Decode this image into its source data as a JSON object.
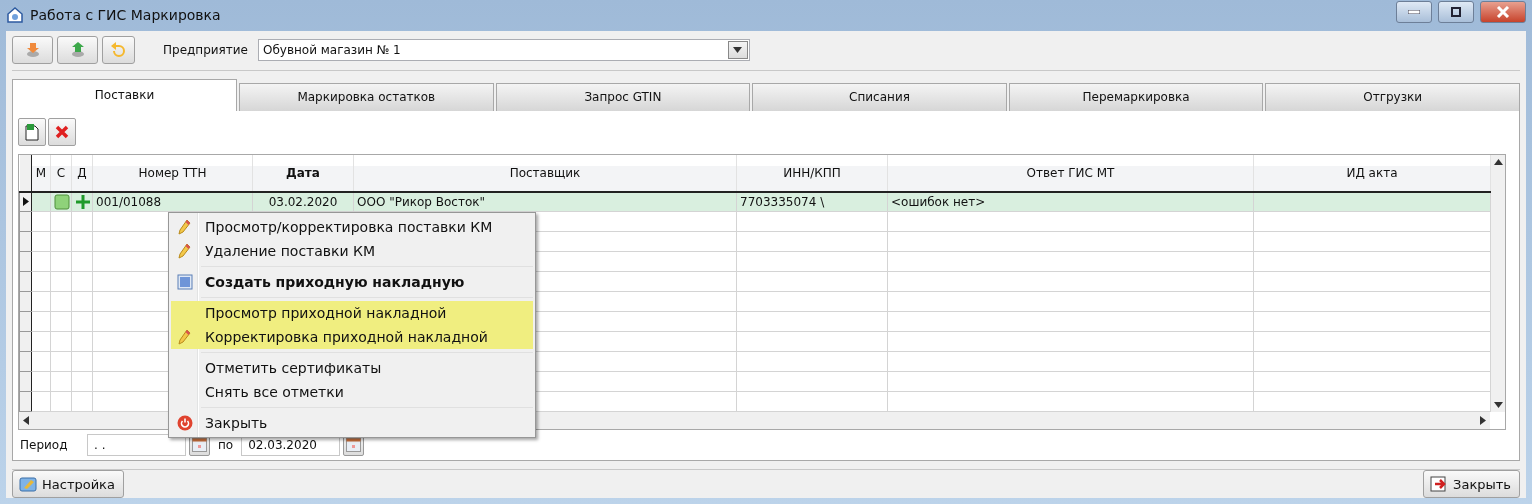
{
  "window": {
    "title": "Работа с ГИС Маркировка"
  },
  "enterprise": {
    "label": "Предприятие",
    "value": "Обувной магазин № 1"
  },
  "tabs": [
    {
      "label": "Поставки",
      "selected": true
    },
    {
      "label": "Маркировка остатков",
      "selected": false
    },
    {
      "label": "Запрос GTIN",
      "selected": false
    },
    {
      "label": "Списания",
      "selected": false
    },
    {
      "label": "Перемаркировка",
      "selected": false
    },
    {
      "label": "Отгрузки",
      "selected": false
    }
  ],
  "table": {
    "columns": [
      {
        "label": "М",
        "sorted": false
      },
      {
        "label": "С",
        "sorted": false
      },
      {
        "label": "Д",
        "sorted": false
      },
      {
        "label": "Номер ТТН",
        "sorted": false
      },
      {
        "label": "Дата",
        "sorted": true
      },
      {
        "label": "Поставщик",
        "sorted": false
      },
      {
        "label": "ИНН/КПП",
        "sorted": false
      },
      {
        "label": "Ответ ГИС МТ",
        "sorted": false
      },
      {
        "label": "ИД акта",
        "sorted": false
      }
    ],
    "rows": [
      {
        "current": true,
        "selected": true,
        "confirmed": true,
        "added": true,
        "number": "001/01088",
        "date": "03.02.2020",
        "supplier": "ООО \"Рикор Восток\"",
        "inn_kpp": "7703335074   \\",
        "response": "<ошибок нет>"
      }
    ]
  },
  "context_menu": [
    {
      "kind": "edit",
      "label": "Просмотр/корректировка поставки КМ",
      "bold": false,
      "highlighted": false
    },
    {
      "kind": "edit",
      "label": "Удаление поставки КМ",
      "bold": false,
      "highlighted": false
    },
    {
      "kind": "separator"
    },
    {
      "kind": "create",
      "label": "Создать приходную накладную",
      "bold": true,
      "highlighted": false
    },
    {
      "kind": "separator"
    },
    {
      "kind": "plain",
      "label": "Просмотр приходной накладной",
      "bold": false,
      "highlighted": true
    },
    {
      "kind": "edit",
      "label": "Корректировка приходной накладной",
      "bold": false,
      "highlighted": true
    },
    {
      "kind": "separator"
    },
    {
      "kind": "plain",
      "label": "Отметить сертификаты",
      "bold": false,
      "highlighted": false
    },
    {
      "kind": "plain",
      "label": "Снять все отметки",
      "bold": false,
      "highlighted": false
    },
    {
      "kind": "separator"
    },
    {
      "kind": "close",
      "label": "Закрыть",
      "bold": false,
      "highlighted": false
    }
  ],
  "period": {
    "label": "Период",
    "from": ". .",
    "to_label": "по",
    "to": "02.03.2020"
  },
  "footer": {
    "settings_button": "Настройка",
    "close_button": "Закрыть"
  }
}
